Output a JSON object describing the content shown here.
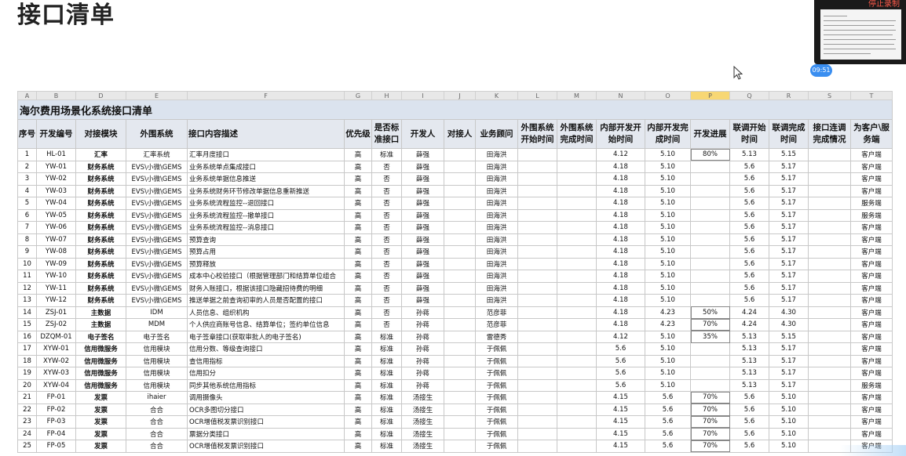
{
  "slide_title": "接口清单",
  "video_overlay": {
    "stop_label": "停止录制",
    "timer": "09:51"
  },
  "sheet": {
    "column_letters": [
      "A",
      "B",
      "D",
      "E",
      "F",
      "G",
      "H",
      "I",
      "J",
      "K",
      "L",
      "M",
      "N",
      "O",
      "P",
      "Q",
      "R",
      "S",
      "T"
    ],
    "selected_column": "P",
    "title": "海尔费用场景化系统接口清单",
    "headers": [
      "序号",
      "开发编号",
      "对接模块",
      "外围系统",
      "接口内容描述",
      "优先级",
      "是否标准接口",
      "开发人",
      "对接人",
      "业务顾问",
      "外围系统开始时间",
      "外围系统完成时间",
      "内部开发开始时间",
      "内部开发完成时间",
      "开发进展",
      "联调开始时间",
      "联调完成时间",
      "接口连调完成情况",
      "为客户\\服务端"
    ],
    "rows": [
      [
        "1",
        "HL-01",
        "汇率",
        "汇率系统",
        "汇率月度接口",
        "高",
        "标准",
        "薛强",
        "",
        "田海洪",
        "",
        "",
        "4.12",
        "5.10",
        "80%",
        "5.13",
        "5.15",
        "",
        "客户端"
      ],
      [
        "2",
        "YW-01",
        "财务系统",
        "EVS\\小微\\GEMS",
        "业务系统单点集成接口",
        "高",
        "否",
        "薛强",
        "",
        "田海洪",
        "",
        "",
        "4.18",
        "5.10",
        "",
        "5.6",
        "5.17",
        "",
        "客户端"
      ],
      [
        "3",
        "YW-02",
        "财务系统",
        "EVS\\小微\\GEMS",
        "业务系统单据信息推送",
        "高",
        "否",
        "薛强",
        "",
        "田海洪",
        "",
        "",
        "4.18",
        "5.10",
        "",
        "5.6",
        "5.17",
        "",
        "客户端"
      ],
      [
        "4",
        "YW-03",
        "财务系统",
        "EVS\\小微\\GEMS",
        "业务系统财务环节修改单据信息重新推送",
        "高",
        "否",
        "薛强",
        "",
        "田海洪",
        "",
        "",
        "4.18",
        "5.10",
        "",
        "5.6",
        "5.17",
        "",
        "客户端"
      ],
      [
        "5",
        "YW-04",
        "财务系统",
        "EVS\\小微\\GEMS",
        "业务系统流程监控--退回接口",
        "高",
        "否",
        "薛强",
        "",
        "田海洪",
        "",
        "",
        "4.18",
        "5.10",
        "",
        "5.6",
        "5.17",
        "",
        "服务端"
      ],
      [
        "6",
        "YW-05",
        "财务系统",
        "EVS\\小微\\GEMS",
        "业务系统流程监控--撤单接口",
        "高",
        "否",
        "薛强",
        "",
        "田海洪",
        "",
        "",
        "4.18",
        "5.10",
        "",
        "5.6",
        "5.17",
        "",
        "服务端"
      ],
      [
        "7",
        "YW-06",
        "财务系统",
        "EVS\\小微\\GEMS",
        "业务系统流程监控--消息接口",
        "高",
        "否",
        "薛强",
        "",
        "田海洪",
        "",
        "",
        "4.18",
        "5.10",
        "",
        "5.6",
        "5.17",
        "",
        "客户端"
      ],
      [
        "8",
        "YW-07",
        "财务系统",
        "EVS\\小微\\GEMS",
        "预算查询",
        "高",
        "否",
        "薛强",
        "",
        "田海洪",
        "",
        "",
        "4.18",
        "5.10",
        "",
        "5.6",
        "5.17",
        "",
        "客户端"
      ],
      [
        "9",
        "YW-08",
        "财务系统",
        "EVS\\小微\\GEMS",
        "预算占用",
        "高",
        "否",
        "薛强",
        "",
        "田海洪",
        "",
        "",
        "4.18",
        "5.10",
        "",
        "5.6",
        "5.17",
        "",
        "客户端"
      ],
      [
        "10",
        "YW-09",
        "财务系统",
        "EVS\\小微\\GEMS",
        "预算释放",
        "高",
        "否",
        "薛强",
        "",
        "田海洪",
        "",
        "",
        "4.18",
        "5.10",
        "",
        "5.6",
        "5.17",
        "",
        "客户端"
      ],
      [
        "11",
        "YW-10",
        "财务系统",
        "EVS\\小微\\GEMS",
        "成本中心校验接口（根据管理部门和结算单位组合",
        "高",
        "否",
        "薛强",
        "",
        "田海洪",
        "",
        "",
        "4.18",
        "5.10",
        "",
        "5.6",
        "5.17",
        "",
        "客户端"
      ],
      [
        "12",
        "YW-11",
        "财务系统",
        "EVS\\小微\\GEMS",
        "财务入账接口，根据该接口隐藏招待费的明细",
        "高",
        "否",
        "薛强",
        "",
        "田海洪",
        "",
        "",
        "4.18",
        "5.10",
        "",
        "5.6",
        "5.17",
        "",
        "客户端"
      ],
      [
        "13",
        "YW-12",
        "财务系统",
        "EVS\\小微\\GEMS",
        "推送单据之前查询初审的人员是否配置的接口",
        "高",
        "否",
        "薛强",
        "",
        "田海洪",
        "",
        "",
        "4.18",
        "5.10",
        "",
        "5.6",
        "5.17",
        "",
        "客户端"
      ],
      [
        "14",
        "ZSJ-01",
        "主数据",
        "IDM",
        "人员信息、组织机构",
        "高",
        "否",
        "孙蒋",
        "",
        "范彦菲",
        "",
        "",
        "4.18",
        "4.23",
        "50%",
        "4.24",
        "4.30",
        "",
        "客户端"
      ],
      [
        "15",
        "ZSJ-02",
        "主数据",
        "MDM",
        "个人供应商账号信息、结算单位；签约单位信息",
        "高",
        "否",
        "孙蒋",
        "",
        "范彦菲",
        "",
        "",
        "4.18",
        "4.23",
        "70%",
        "4.24",
        "4.30",
        "",
        "客户端"
      ],
      [
        "16",
        "DZQM-01",
        "电子签名",
        "电子签名",
        "电子签章接口(获取审批人的电子签名)",
        "高",
        "标准",
        "孙蒋",
        "",
        "雷德秀",
        "",
        "",
        "4.12",
        "5.10",
        "35%",
        "5.13",
        "5.15",
        "",
        "客户端"
      ],
      [
        "17",
        "XYW-01",
        "信用微服务",
        "信用模块",
        "信用分数、等级查询接口",
        "高",
        "标准",
        "孙蒋",
        "",
        "于佩佩",
        "",
        "",
        "5.6",
        "5.10",
        "",
        "5.13",
        "5.17",
        "",
        "客户端"
      ],
      [
        "18",
        "XYW-02",
        "信用微服务",
        "信用模块",
        "查信用指标",
        "高",
        "标准",
        "孙蒋",
        "",
        "于佩佩",
        "",
        "",
        "5.6",
        "5.10",
        "",
        "5.13",
        "5.17",
        "",
        "客户端"
      ],
      [
        "19",
        "XYW-03",
        "信用微服务",
        "信用模块",
        "信用扣分",
        "高",
        "标准",
        "孙蒋",
        "",
        "于佩佩",
        "",
        "",
        "5.6",
        "5.10",
        "",
        "5.13",
        "5.17",
        "",
        "客户端"
      ],
      [
        "20",
        "XYW-04",
        "信用微服务",
        "信用模块",
        "同步其他系统信用指标",
        "高",
        "标准",
        "孙蒋",
        "",
        "于佩佩",
        "",
        "",
        "5.6",
        "5.10",
        "",
        "5.13",
        "5.17",
        "",
        "服务端"
      ],
      [
        "21",
        "FP-01",
        "发票",
        "ihaier",
        "调用摄像头",
        "高",
        "标准",
        "汤接生",
        "",
        "于佩佩",
        "",
        "",
        "4.15",
        "5.6",
        "70%",
        "5.6",
        "5.10",
        "",
        "客户端"
      ],
      [
        "22",
        "FP-02",
        "发票",
        "合合",
        "OCR多图切分接口",
        "高",
        "标准",
        "汤接生",
        "",
        "于佩佩",
        "",
        "",
        "4.15",
        "5.6",
        "70%",
        "5.6",
        "5.10",
        "",
        "客户端"
      ],
      [
        "23",
        "FP-03",
        "发票",
        "合合",
        "OCR增值税发票识别接口",
        "高",
        "标准",
        "汤接生",
        "",
        "于佩佩",
        "",
        "",
        "4.15",
        "5.6",
        "70%",
        "5.6",
        "5.10",
        "",
        "客户端"
      ],
      [
        "24",
        "FP-04",
        "发票",
        "合合",
        "票据分类接口",
        "高",
        "标准",
        "汤接生",
        "",
        "于佩佩",
        "",
        "",
        "4.15",
        "5.6",
        "70%",
        "5.6",
        "5.10",
        "",
        "客户端"
      ],
      [
        "25",
        "FP-05",
        "发票",
        "合合",
        "OCR增值税发票识别接口",
        "高",
        "标准",
        "汤接生",
        "",
        "于佩佩",
        "",
        "",
        "4.15",
        "5.6",
        "70%",
        "5.6",
        "5.10",
        "",
        "客户端"
      ]
    ]
  }
}
